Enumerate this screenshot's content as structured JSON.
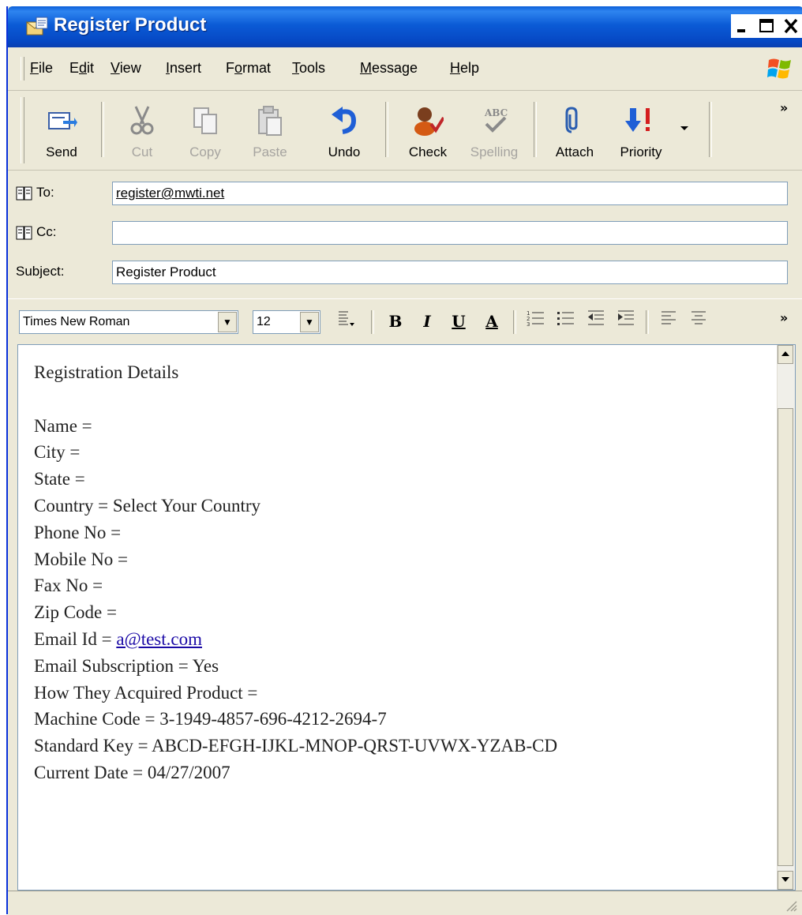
{
  "window": {
    "title": "Register Product"
  },
  "menu": [
    {
      "pre": "",
      "ul": "F",
      "post": "ile"
    },
    {
      "pre": "E",
      "ul": "d",
      "post": "it"
    },
    {
      "pre": "",
      "ul": "V",
      "post": "iew"
    },
    {
      "pre": "",
      "ul": "I",
      "post": "nsert"
    },
    {
      "pre": "F",
      "ul": "o",
      "post": "rmat"
    },
    {
      "pre": "",
      "ul": "T",
      "post": "ools"
    },
    {
      "pre": "",
      "ul": "M",
      "post": "essage"
    },
    {
      "pre": "",
      "ul": "H",
      "post": "elp"
    }
  ],
  "toolbar": {
    "send": "Send",
    "cut": "Cut",
    "copy": "Copy",
    "paste": "Paste",
    "undo": "Undo",
    "check": "Check",
    "spelling": "Spelling",
    "attach": "Attach",
    "priority": "Priority",
    "more": "»"
  },
  "headers": {
    "to_label": "To:",
    "to_value": "register@mwti.net",
    "cc_label": "Cc:",
    "cc_value": "",
    "subject_label": "Subject:",
    "subject_value": "Register Product"
  },
  "format": {
    "font": "Times New Roman",
    "size": "12",
    "bold": "B",
    "italic": "I",
    "underline": "U",
    "color": "A",
    "more": "»"
  },
  "body": {
    "heading": "Registration Details",
    "lines": [
      "Name =",
      "City =",
      "State =",
      "Country = Select Your Country",
      "Phone No =",
      "Mobile No =",
      "Fax No =",
      "Zip Code ="
    ],
    "email_prefix": "Email Id = ",
    "email_link": "a@test.com",
    "lines2": [
      "Email Subscription = Yes",
      "How They Acquired Product =",
      "Machine Code = 3-1949-4857-696-4212-2694-7",
      "Standard Key = ABCD-EFGH-IJKL-MNOP-QRST-UVWX-YZAB-CD",
      "Current Date = 04/27/2007"
    ]
  },
  "colors": {
    "titlebar": "#0a5ed8",
    "chrome": "#ece9d8",
    "link": "#1b0aa6"
  }
}
